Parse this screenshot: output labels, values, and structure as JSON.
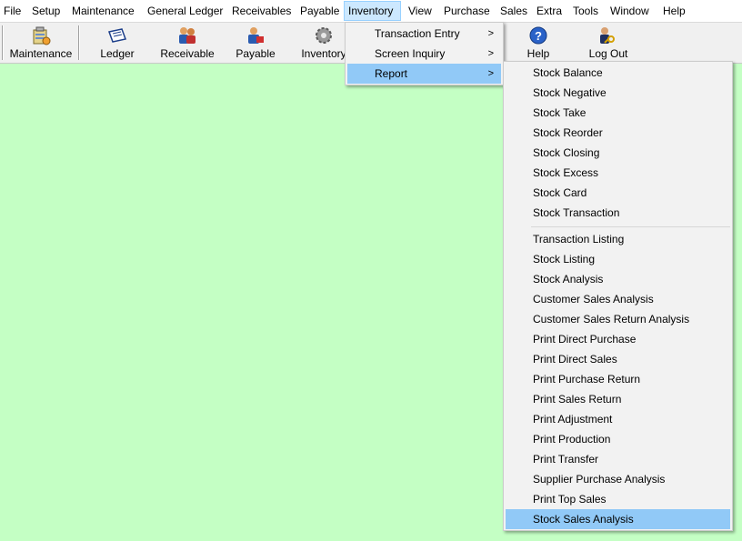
{
  "menubar": {
    "items": [
      "File",
      "Setup",
      "Maintenance",
      "General Ledger",
      "Receivables",
      "Payable",
      "Inventory",
      "View",
      "Purchase",
      "Sales",
      "Extra",
      "Tools",
      "Window",
      "Help"
    ],
    "open_item": "Inventory"
  },
  "toolbar": {
    "buttons": [
      {
        "label": "Maintenance",
        "icon": "maintenance-icon"
      },
      {
        "label": "Ledger",
        "icon": "ledger-icon"
      },
      {
        "label": "Receivable",
        "icon": "receivable-icon"
      },
      {
        "label": "Payable",
        "icon": "payable-icon"
      },
      {
        "label": "Inventory",
        "icon": "inventory-icon"
      },
      {
        "label": "Help",
        "icon": "help-icon"
      },
      {
        "label": "Log Out",
        "icon": "logout-icon"
      }
    ]
  },
  "inventory_menu": {
    "items": [
      {
        "label": "Transaction Entry",
        "submenu": true
      },
      {
        "label": "Screen Inquiry",
        "submenu": true
      },
      {
        "label": "Report",
        "submenu": true,
        "highlighted": true
      }
    ],
    "submenu_arrow": ">"
  },
  "report_menu": {
    "group1": [
      "Stock Balance",
      "Stock Negative",
      "Stock Take",
      "Stock Reorder",
      "Stock Closing",
      "Stock Excess",
      "Stock Card",
      "Stock Transaction"
    ],
    "group2": [
      "Transaction Listing",
      "Stock Listing",
      "Stock Analysis",
      "Customer Sales Analysis",
      "Customer Sales Return Analysis",
      "Print Direct Purchase",
      "Print Direct Sales",
      "Print Purchase Return",
      "Print Sales Return",
      "Print Adjustment",
      "Print Production",
      "Print Transfer",
      "Supplier Purchase Analysis",
      "Print Top Sales",
      "Stock Sales Analysis"
    ],
    "highlighted": "Stock Sales Analysis"
  },
  "colors": {
    "workspace_bg": "#c4ffc4",
    "menu_highlight": "#91c9f7",
    "menubar_open": "#cce8ff"
  }
}
